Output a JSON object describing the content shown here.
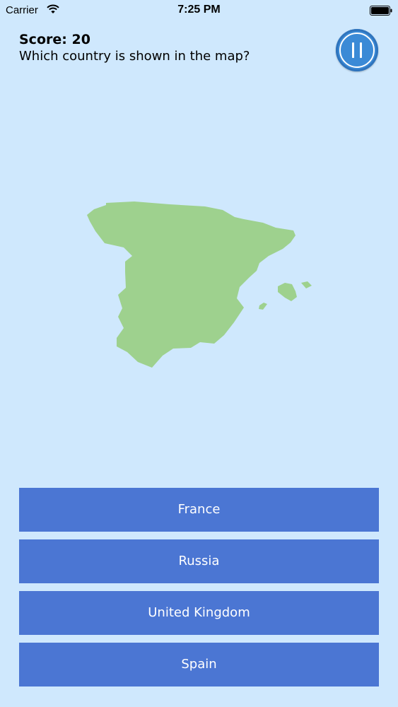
{
  "status_bar": {
    "carrier": "Carrier",
    "time": "7:25 PM"
  },
  "header": {
    "score_label": "Score:",
    "score_value": "20",
    "question": "Which country is shown in the map?"
  },
  "pause_button": {
    "icon": "pause-icon"
  },
  "map": {
    "country_shape": "spain-map",
    "fill_color": "#9ed18e"
  },
  "answers": [
    {
      "label": "France"
    },
    {
      "label": "Russia"
    },
    {
      "label": "United Kingdom"
    },
    {
      "label": "Spain"
    }
  ],
  "colors": {
    "background": "#cfe8fd",
    "answer_button": "#4b76d3",
    "pause_button": "#3b8ad6"
  }
}
